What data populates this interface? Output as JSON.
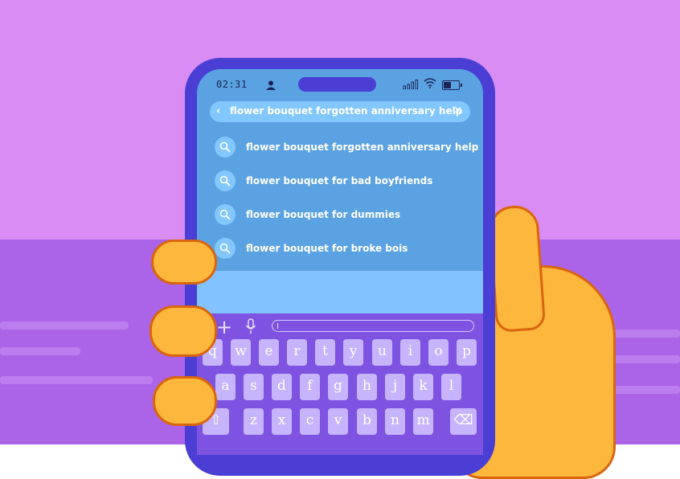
{
  "status": {
    "time": "02:31"
  },
  "search": {
    "query": "flower bouquet forgotten anniversary help",
    "back_icon": "‹",
    "clear_icon": "×"
  },
  "suggestions": [
    "flower bouquet forgotten anniversary help",
    "flower bouquet for bad boyfriends",
    "flower bouquet for dummies",
    "flower bouquet for broke bois"
  ],
  "keyboard": {
    "row1": [
      "q",
      "w",
      "e",
      "r",
      "t",
      "y",
      "u",
      "i",
      "o",
      "p"
    ],
    "row2": [
      "a",
      "s",
      "d",
      "f",
      "g",
      "h",
      "j",
      "k",
      "l"
    ],
    "row3": [
      "z",
      "x",
      "c",
      "v",
      "b",
      "n",
      "m"
    ],
    "shift_icon": "⇧",
    "delete_icon": "⌫",
    "plus_icon": "+"
  },
  "colors": {
    "sky": "#d98cf4",
    "floor": "#ab64e8",
    "phone": "#4a3ed4",
    "screen": "#5ba2e2",
    "keyboard": "#7e53e2",
    "hand": "#fdb73c"
  }
}
